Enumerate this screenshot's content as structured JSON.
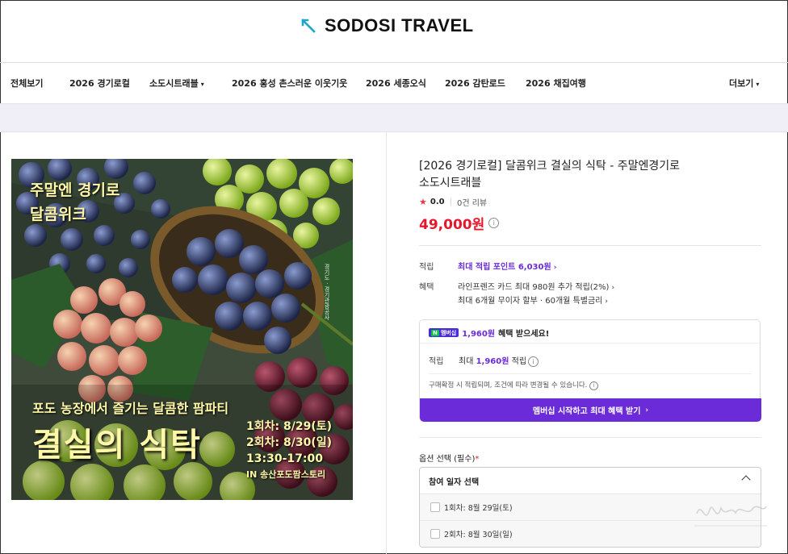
{
  "brand": {
    "name": "SODOSI TRAVEL"
  },
  "nav": {
    "items": [
      "전체보기",
      "2026 경기로컬",
      "소도시트래블",
      "2026 홍성 촌스러운 이웃기웃",
      "2026 세종오식",
      "2026 감탄로드",
      "2026 채집여행"
    ],
    "more": "더보기"
  },
  "hero": {
    "top_line1": "주말엔 경기로",
    "top_line2": "달콤위크",
    "tagline": "포도 농장에서 즐기는 달콤한 팜파티",
    "big_title": "결실의 식탁",
    "schedule": [
      "1회차: 8/29(토)",
      "2회차: 8/30(일)",
      "13:30-17:00",
      "IN 송산포도팜스토리"
    ],
    "vertical_text": "경기도 · 경기관광공사"
  },
  "product": {
    "title_line1": "[2026 경기로컬] 달콤위크 결실의 식탁 - 주말엔경기로",
    "title_line2": "소도시트래블",
    "rating": "0.0",
    "reviews": "0건 리뷰",
    "price": "49,000원"
  },
  "benefits": {
    "points_label": "적립",
    "points_value": "최대 적립 포인트 6,030원",
    "card_label": "혜택",
    "card_line1": "라인프렌즈 카드 최대 980원 추가 적립(2%)",
    "card_line2": "최대 6개월 무이자 할부 · 60개월 특별금리"
  },
  "membership": {
    "badge": "멤버십",
    "headline_amount": "1,960원",
    "headline_rest": "혜택 받으세요!",
    "earn_label": "적립",
    "earn_prefix": "최대",
    "earn_amount": "1,960원",
    "earn_suffix": "적립",
    "notice": "구매확정 시 적립되며, 조건에 따라 변경될 수 있습니다.",
    "cta": "멤버십 시작하고 최대 혜택 받기"
  },
  "options": {
    "label": "옵션 선택 (필수)",
    "required_mark": "*",
    "select_title": "참여 일자 선택",
    "items": [
      "1회차: 8월 29일(토)",
      "2회차: 8월 30일(일)"
    ]
  },
  "colors": {
    "price": "#e2192d",
    "accent": "#6b2bd9",
    "hero_text": "#fff7a8"
  }
}
